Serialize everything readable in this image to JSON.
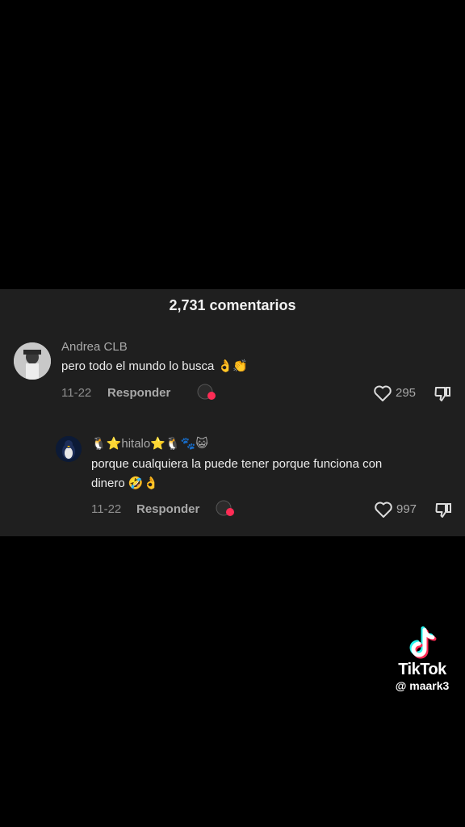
{
  "header": {
    "comment_count": "2,731 comentarios"
  },
  "comments": [
    {
      "username": "Andrea CLB",
      "text": "pero todo el mundo lo busca 👌👏",
      "date": "11-22",
      "reply_label": "Responder",
      "likes": "295"
    },
    {
      "username": "🐧⭐hitalo⭐🐧🐾😺",
      "text_line1": "porque cualquiera la puede tener porque funciona con",
      "text_line2": "dinero 🤣👌",
      "date": "11-22",
      "reply_label": "Responder",
      "likes": "997"
    }
  ],
  "watermark": {
    "brand": "TikTok",
    "handle": "@ maark3"
  }
}
